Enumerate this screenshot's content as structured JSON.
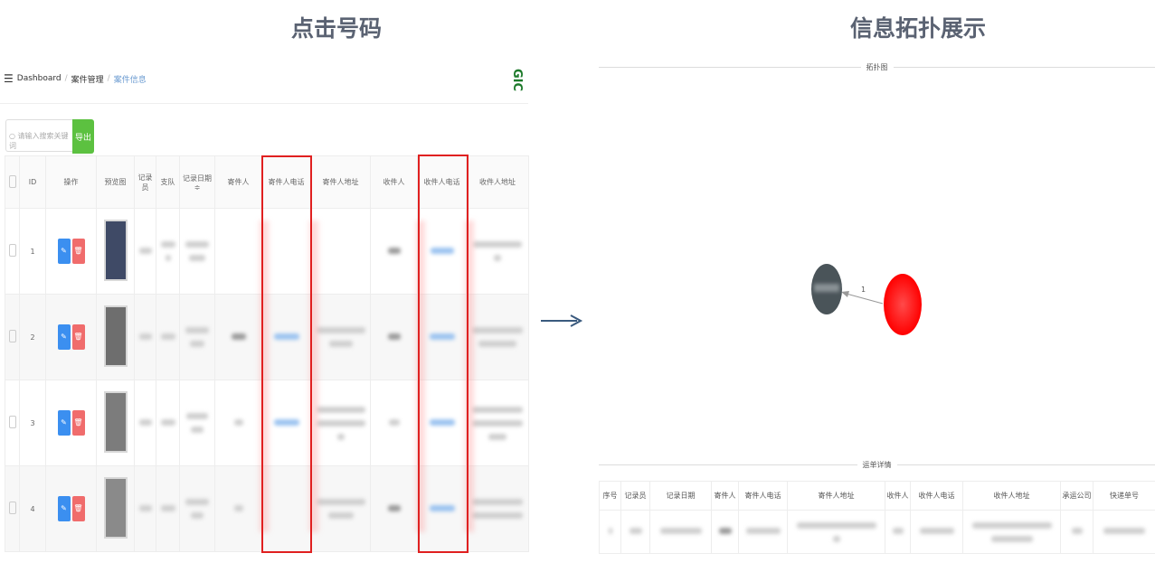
{
  "titles": {
    "left": "点击号码",
    "right": "信息拓扑展示"
  },
  "left_panel": {
    "breadcrumb": [
      "Dashboard",
      "案件管理",
      "案件信息"
    ],
    "logo": "GIC",
    "search_placeholder": "请输入搜索关键词",
    "export_label": "导出",
    "columns": [
      "",
      "ID",
      "操作",
      "预览图",
      "记录员",
      "支队",
      "记录日期 ≑",
      "寄件人",
      "寄件人电话",
      "寄件人地址",
      "收件人",
      "收件人电话",
      "收件人地址"
    ],
    "rows": [
      {
        "id": "1"
      },
      {
        "id": "2"
      },
      {
        "id": "3"
      },
      {
        "id": "4"
      }
    ],
    "edit_icon": "edit-icon",
    "delete_icon": "delete-icon"
  },
  "right_panel": {
    "topology_label": "拓扑图",
    "edge_label": "1",
    "node_colors": {
      "source": "#4a5459",
      "target": "#ff0000"
    },
    "detail_label": "运单详情",
    "detail_columns": [
      "序号",
      "记录员",
      "记录日期",
      "寄件人",
      "寄件人电话",
      "寄件人地址",
      "收件人",
      "收件人电话",
      "收件人地址",
      "承运公司",
      "快递单号"
    ]
  },
  "colors": {
    "highlight": "#e02020",
    "export_button": "#5cc140",
    "edit_button": "#3b8ff0",
    "delete_button": "#f06c6c",
    "title": "#5a6272",
    "arrow": "#3a5a7e"
  }
}
